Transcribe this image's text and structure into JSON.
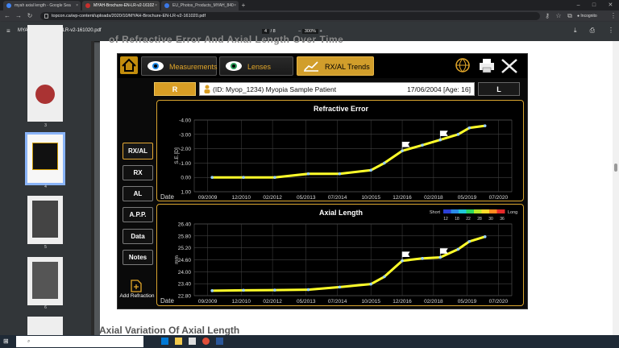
{
  "browser": {
    "tabs": [
      {
        "title": "myah axial length - Google Sea"
      },
      {
        "title": "MYAH-Brochure-EN-LR-v2-16102"
      },
      {
        "title": "EU_Photos_Products_MYAH_840"
      }
    ],
    "url": "topcon.ca/wp-content/uploads/2020/10/MYAH-Brochure-EN-LR-v2-161020.pdf",
    "profile_label": "Incognito"
  },
  "pdf": {
    "filename": "MYAH-Brochure-EN-LR-v2-161020.pdf",
    "current_page": "4",
    "page_total": "/ 8",
    "zoom": "300%",
    "thumbnail_labels": [
      "2",
      "3",
      "4",
      "5",
      "6"
    ],
    "selected_thumbnail": "4",
    "heading_partial": "of Refractive Error And Axial Length Over Time",
    "footer_partial": "Axial Variation Of Axial Length"
  },
  "app": {
    "tabs": [
      {
        "label": "Measurements",
        "icon": "eye-measurement-icon"
      },
      {
        "label": "Lenses",
        "icon": "eye-lens-icon"
      },
      {
        "label": "RX/AL Trends",
        "icon": "trend-icon",
        "active": true
      }
    ],
    "eye_right": "R",
    "eye_left": "L",
    "patient": {
      "label": "(ID: Myop_1234) Myopia Sample Patient",
      "dob": "17/06/2004 [Age: 16]"
    },
    "menu": [
      "RX/AL",
      "RX",
      "AL",
      "A.P.P.",
      "Data",
      "Notes"
    ],
    "menu_active": "RX/AL",
    "add_refraction_label": "Add Refraction",
    "colors": {
      "accent": "#d19e2b",
      "series": "#ffff2a"
    }
  },
  "chart_data": [
    {
      "type": "line",
      "title": "Refractive Error",
      "ylabel": "S.E.[D]",
      "xlabel": "Date",
      "x_ticks": [
        "09/2009",
        "12/2010",
        "02/2012",
        "05/2013",
        "07/2014",
        "10/2015",
        "12/2016",
        "02/2018",
        "05/2019",
        "07/2020"
      ],
      "y_ticks": [
        "-4.00",
        "-3.00",
        "-2.00",
        "-1.00",
        "0.00",
        "1.00"
      ],
      "ylim": [
        1.0,
        -4.0
      ],
      "y_inverted": true,
      "x": [
        "2009-11",
        "2011-01",
        "2012-03",
        "2013-06",
        "2014-08",
        "2015-10",
        "2016-04",
        "2016-12",
        "2017-09",
        "2018-05",
        "2019-01",
        "2019-06",
        "2020-01"
      ],
      "values": [
        0.0,
        0.0,
        0.0,
        -0.25,
        -0.25,
        -0.5,
        -1.0,
        -1.85,
        -2.25,
        -2.62,
        -3.0,
        -3.45,
        -3.6
      ],
      "flags_at": [
        "2016-12",
        "2018-05"
      ]
    },
    {
      "type": "line",
      "title": "Axial Length",
      "ylabel": "mm",
      "xlabel": "Date",
      "x_ticks": [
        "09/2009",
        "12/2010",
        "02/2012",
        "05/2013",
        "07/2014",
        "10/2015",
        "12/2016",
        "02/2018",
        "05/2019",
        "07/2020"
      ],
      "y_ticks": [
        "26.40",
        "25.80",
        "25.20",
        "24.60",
        "24.00",
        "23.40",
        "22.80"
      ],
      "ylim": [
        22.8,
        26.4
      ],
      "x": [
        "2009-11",
        "2011-01",
        "2012-03",
        "2013-06",
        "2014-08",
        "2015-10",
        "2016-04",
        "2016-12",
        "2017-09",
        "2018-05",
        "2019-01",
        "2019-06",
        "2020-01"
      ],
      "values": [
        23.05,
        23.07,
        23.08,
        23.1,
        23.23,
        23.38,
        23.75,
        24.55,
        24.67,
        24.72,
        25.13,
        25.52,
        25.76
      ],
      "flags_at": [
        "2016-12",
        "2018-05"
      ],
      "legend": {
        "short_label": "Short",
        "long_label": "Long",
        "ticks": [
          "12",
          "18",
          "22",
          "28",
          "30",
          "36"
        ]
      }
    }
  ]
}
